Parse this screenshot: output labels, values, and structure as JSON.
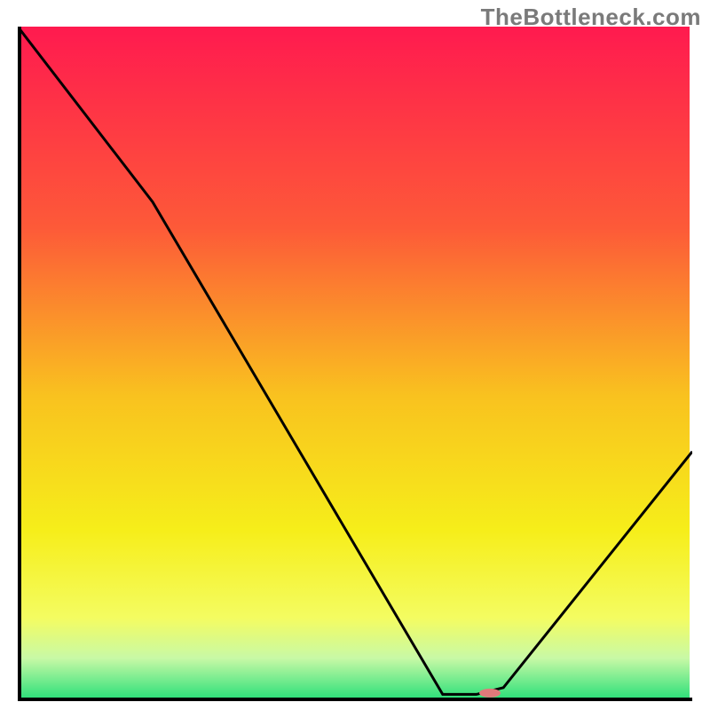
{
  "watermark": "TheBottleneck.com",
  "chart_data": {
    "type": "line",
    "title": "",
    "xlabel": "",
    "ylabel": "",
    "xlim": [
      0,
      100
    ],
    "ylim": [
      0,
      100
    ],
    "series": [
      {
        "name": "curve",
        "x": [
          0,
          20,
          63,
          68,
          72,
          100
        ],
        "values": [
          100,
          74,
          1,
          1,
          2,
          37
        ]
      }
    ],
    "background_gradient": {
      "stops": [
        {
          "offset": 0.0,
          "color": "#ff1a4f"
        },
        {
          "offset": 0.3,
          "color": "#fd5a38"
        },
        {
          "offset": 0.55,
          "color": "#f9c21f"
        },
        {
          "offset": 0.75,
          "color": "#f6ee1a"
        },
        {
          "offset": 0.88,
          "color": "#f4fc61"
        },
        {
          "offset": 0.94,
          "color": "#c8f9a6"
        },
        {
          "offset": 1.0,
          "color": "#2ee07a"
        }
      ]
    },
    "marker": {
      "x": 70,
      "y": 1.2,
      "color": "#e07a7a",
      "rx": 12,
      "ry": 5
    },
    "axis_color": "#000000",
    "curve_color": "#000000"
  }
}
